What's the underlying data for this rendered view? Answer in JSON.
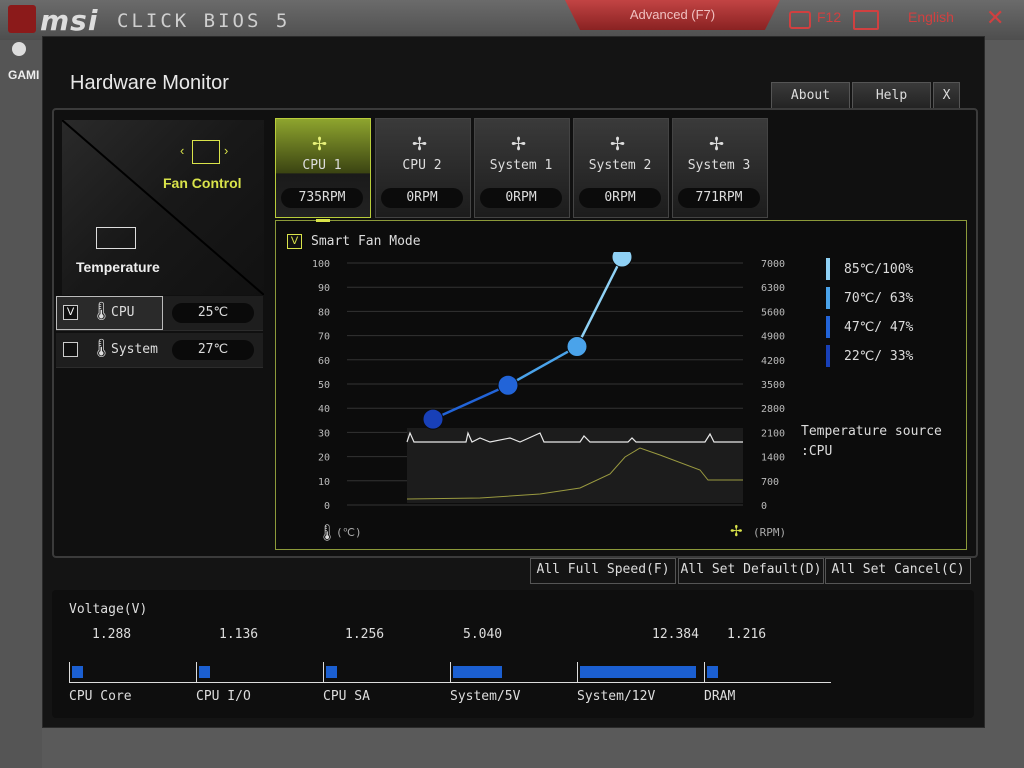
{
  "app": {
    "brand": "msi",
    "product": "CLICK BIOS 5",
    "mode_tab": "Advanced (F7)",
    "screenshot_key": "F12",
    "language": "English",
    "side_label": "GAMI"
  },
  "window": {
    "title": "Hardware Monitor",
    "about": "About",
    "help": "Help",
    "close": "X"
  },
  "left": {
    "fan_control_label": "Fan Control",
    "temperature_label": "Temperature",
    "sources": [
      {
        "name": "CPU",
        "value": "25℃",
        "checked": true,
        "check_mark": "V"
      },
      {
        "name": "System",
        "value": "27℃",
        "checked": false,
        "check_mark": ""
      }
    ]
  },
  "fans": [
    {
      "name": "CPU 1",
      "rpm": "735RPM",
      "active": true
    },
    {
      "name": "CPU 2",
      "rpm": "0RPM",
      "active": false
    },
    {
      "name": "System 1",
      "rpm": "0RPM",
      "active": false
    },
    {
      "name": "System 2",
      "rpm": "0RPM",
      "active": false
    },
    {
      "name": "System 3",
      "rpm": "771RPM",
      "active": false
    }
  ],
  "smart_fan": {
    "check_mark": "V",
    "label": "Smart Fan Mode"
  },
  "graph": {
    "left_ticks": [
      "100",
      "90",
      "80",
      "70",
      "60",
      "50",
      "40",
      "30",
      "20",
      "10",
      "0"
    ],
    "right_ticks": [
      "7000",
      "6300",
      "5600",
      "4900",
      "4200",
      "3500",
      "2800",
      "2100",
      "1400",
      "700",
      "0"
    ],
    "left_unit": "(℃)",
    "right_unit": "(RPM)",
    "curve_points": [
      {
        "temp": 22,
        "pct": 33
      },
      {
        "temp": 47,
        "pct": 47
      },
      {
        "temp": 70,
        "pct": 63
      },
      {
        "temp": 85,
        "pct": 100
      }
    ],
    "legend": [
      {
        "text": "85℃/100%",
        "color": "#8fd1f5"
      },
      {
        "text": "70℃/ 63%",
        "color": "#4aa3ea"
      },
      {
        "text": "47℃/ 47%",
        "color": "#2264d8"
      },
      {
        "text": "22℃/ 33%",
        "color": "#1840b8"
      }
    ],
    "temp_source_line1": "Temperature source",
    "temp_source_line2": ":CPU"
  },
  "actions": {
    "full_speed": "All Full Speed(F)",
    "set_default": "All Set Default(D)",
    "set_cancel": "All Set Cancel(C)"
  },
  "voltage": {
    "title": "Voltage(V)",
    "items": [
      {
        "name": "CPU Core",
        "value": "1.288",
        "level": 0.09
      },
      {
        "name": "CPU I/O",
        "value": "1.136",
        "level": 0.09
      },
      {
        "name": "CPU SA",
        "value": "1.256",
        "level": 0.09
      },
      {
        "name": "System/5V",
        "value": "5.040",
        "level": 0.4
      },
      {
        "name": "System/12V",
        "value": "12.384",
        "level": 0.95
      },
      {
        "name": "DRAM",
        "value": "1.216",
        "level": 0.09
      }
    ]
  }
}
